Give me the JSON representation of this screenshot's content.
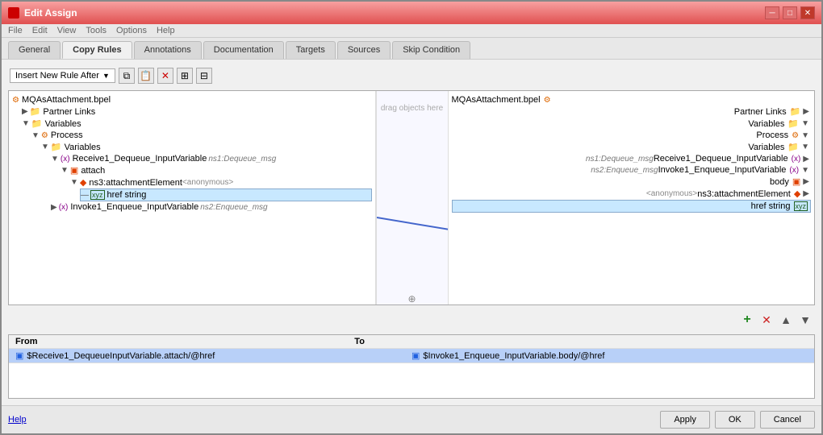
{
  "window": {
    "title": "Edit Assign",
    "close_btn": "✕",
    "min_btn": "─",
    "max_btn": "□"
  },
  "menu_items": [
    "File",
    "Edit",
    "View",
    "Tools",
    "Options",
    "Help"
  ],
  "tabs": [
    {
      "label": "General",
      "active": false
    },
    {
      "label": "Copy Rules",
      "active": true
    },
    {
      "label": "Annotations",
      "active": false
    },
    {
      "label": "Documentation",
      "active": false
    },
    {
      "label": "Targets",
      "active": false
    },
    {
      "label": "Sources",
      "active": false
    },
    {
      "label": "Skip Condition",
      "active": false
    }
  ],
  "toolbar": {
    "dropdown_label": "Insert New Rule After",
    "icons": [
      "copy_icon",
      "paste_icon",
      "delete_icon",
      "move_up_icon",
      "move_down_icon"
    ]
  },
  "left_tree": {
    "root": "MQAsAttachment.bpel",
    "items": [
      {
        "label": "Partner Links",
        "indent": 1,
        "type": "folder",
        "expanded": true
      },
      {
        "label": "Variables",
        "indent": 1,
        "type": "folder",
        "expanded": true
      },
      {
        "label": "Process",
        "indent": 2,
        "type": "process",
        "expanded": true
      },
      {
        "label": "Variables",
        "indent": 3,
        "type": "folder",
        "expanded": true
      },
      {
        "label": "Receive1_Dequeue_InputVariable",
        "indent": 4,
        "type": "variable",
        "type_label": "ns1:Dequeue_msg",
        "expanded": true
      },
      {
        "label": "attach",
        "indent": 5,
        "type": "element",
        "expanded": true
      },
      {
        "label": "ns3:attachmentElement",
        "indent": 6,
        "type": "element",
        "anon": "<anonymous>",
        "expanded": true
      },
      {
        "label": "href string",
        "indent": 7,
        "type": "string",
        "highlighted": true
      },
      {
        "label": "Invoke1_Enqueue_InputVariable",
        "indent": 4,
        "type": "variable",
        "type_label": "ns2:Enqueue_msg",
        "expanded": false
      }
    ]
  },
  "right_tree": {
    "root": "MQAsAttachment.bpel",
    "items": [
      {
        "label": "Partner Links",
        "indent": 1,
        "type": "folder"
      },
      {
        "label": "Variables",
        "indent": 1,
        "type": "folder"
      },
      {
        "label": "Process",
        "indent": 2,
        "type": "process"
      },
      {
        "label": "Variables",
        "indent": 3,
        "type": "folder"
      },
      {
        "label": "Receive1_Dequeue_InputVariable",
        "indent": 4,
        "type": "variable",
        "type_label": "ns1:Dequeue_msg"
      },
      {
        "label": "Invoke1_Enqueue_InputVariable",
        "indent": 4,
        "type": "variable",
        "type_label": "ns2:Enqueue_msg"
      },
      {
        "label": "body",
        "indent": 5,
        "type": "element"
      },
      {
        "label": "ns3:attachmentElement",
        "indent": 6,
        "type": "element",
        "anon": "<anonymous>"
      },
      {
        "label": "href string",
        "indent": 7,
        "type": "string",
        "highlighted": true
      }
    ]
  },
  "center_placeholder": "drag objects here",
  "rules": {
    "from_header": "From",
    "to_header": "To",
    "rows": [
      {
        "from": "$Receive1_DequeueInputVariable.attach/@href",
        "to": "$Invoke1_Enqueue_InputVariable.body/@href"
      }
    ]
  },
  "action_icons": {
    "add": "+",
    "delete": "✕",
    "up": "▲",
    "down": "▼"
  },
  "buttons": {
    "help": "Help",
    "apply": "Apply",
    "ok": "OK",
    "cancel": "Cancel"
  }
}
